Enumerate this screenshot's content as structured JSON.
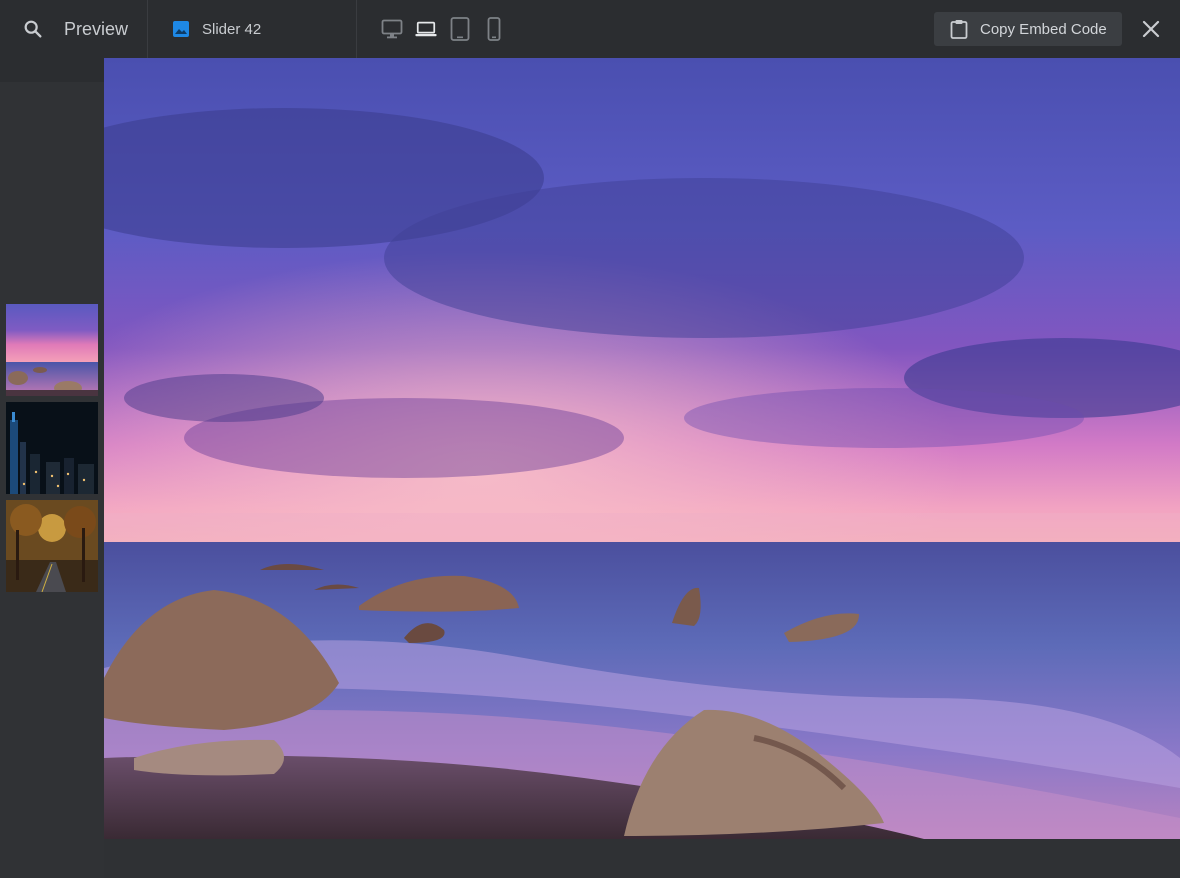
{
  "header": {
    "title": "Preview",
    "slider_name": "Slider 42",
    "copy_button_label": "Copy Embed Code"
  },
  "icons": {
    "search": "search-icon",
    "slider": "image-icon",
    "desktop": "desktop-icon",
    "laptop": "laptop-icon",
    "tablet": "tablet-icon",
    "mobile": "mobile-icon",
    "clipboard": "clipboard-icon",
    "close": "close-icon"
  },
  "devices": {
    "options": [
      "desktop",
      "laptop",
      "tablet",
      "mobile"
    ],
    "selected": "laptop"
  },
  "thumbnails": [
    {
      "name": "sunset-beach",
      "selected": true
    },
    {
      "name": "city-night",
      "selected": false
    },
    {
      "name": "autumn-road",
      "selected": false
    }
  ],
  "colors": {
    "topbar": "#2b2d30",
    "background": "#2f3134",
    "accent": "#1e88e5",
    "button_bg": "#3b3e42"
  }
}
